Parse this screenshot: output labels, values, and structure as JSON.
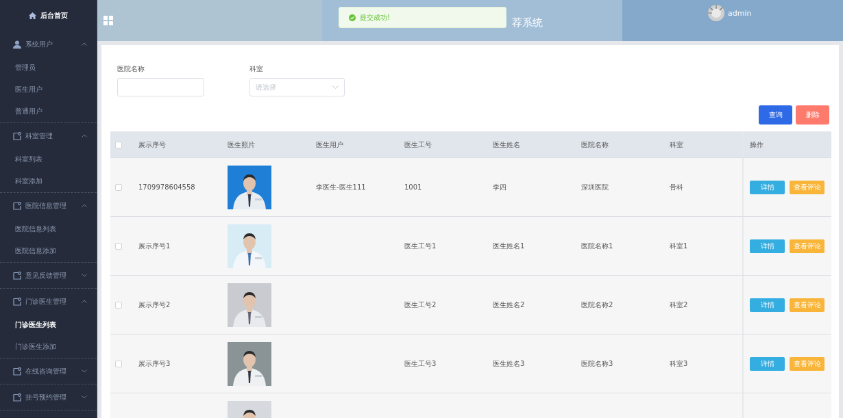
{
  "sidebar": {
    "home": "后台首页",
    "groups": [
      {
        "label": "系统用户",
        "expanded": true,
        "items": [
          {
            "label": "管理员",
            "selected": false
          },
          {
            "label": "医生用户",
            "selected": false
          },
          {
            "label": "普通用户",
            "selected": false
          }
        ]
      },
      {
        "label": "科室管理",
        "expanded": true,
        "items": [
          {
            "label": "科室列表",
            "selected": false
          },
          {
            "label": "科室添加",
            "selected": false
          }
        ]
      },
      {
        "label": "医院信息管理",
        "expanded": true,
        "items": [
          {
            "label": "医院信息列表",
            "selected": false
          },
          {
            "label": "医院信息添加",
            "selected": false
          }
        ]
      },
      {
        "label": "意见反馈管理",
        "expanded": false
      },
      {
        "label": "门诊医生管理",
        "expanded": true,
        "items": [
          {
            "label": "门诊医生列表",
            "selected": true
          },
          {
            "label": "门诊医生添加",
            "selected": false
          }
        ]
      },
      {
        "label": "在线咨询管理",
        "expanded": false
      },
      {
        "label": "挂号预约管理",
        "expanded": false
      }
    ]
  },
  "header": {
    "title": "荐系统",
    "user": "admin",
    "toast": "提交成功!"
  },
  "filters": [
    {
      "label": "医院名称",
      "kind": "input"
    },
    {
      "label": "科室",
      "kind": "select",
      "placeholder": "请选择"
    }
  ],
  "buttons": [
    {
      "label": "查询",
      "kind": "primary"
    },
    {
      "label": "删除",
      "kind": "danger"
    }
  ],
  "table": {
    "all_checked": false,
    "columns": [
      "展示序号",
      "医生照片",
      "医生用户",
      "医生工号",
      "医生姓名",
      "医院名称",
      "科室",
      "操作"
    ],
    "rows": [
      {
        "checked": false,
        "cells": [
          "1709978604558",
          "",
          "李医生-医生111",
          "1001",
          "李四",
          "深圳医院",
          "骨科"
        ],
        "photo": {
          "kind": "picture"
        },
        "actions": [
          "详情",
          "查看评论"
        ]
      },
      {
        "checked": false,
        "cells": [
          "展示序号1",
          "",
          "",
          "医生工号1",
          "医生姓名1",
          "医院名称1",
          "科室1"
        ],
        "photo": {
          "kind": "picture"
        },
        "actions": [
          "详情",
          "查看评论"
        ]
      },
      {
        "checked": false,
        "cells": [
          "展示序号2",
          "",
          "",
          "医生工号2",
          "医生姓名2",
          "医院名称2",
          "科室2"
        ],
        "photo": {
          "kind": "picture"
        },
        "actions": [
          "详情",
          "查看评论"
        ]
      },
      {
        "checked": false,
        "cells": [
          "展示序号3",
          "",
          "",
          "医生工号3",
          "医生姓名3",
          "医院名称3",
          "科室3"
        ],
        "photo": {
          "kind": "picture"
        },
        "actions": [
          "详情",
          "查看评论"
        ]
      },
      {
        "photo": {
          "kind": "picture"
        }
      }
    ]
  }
}
